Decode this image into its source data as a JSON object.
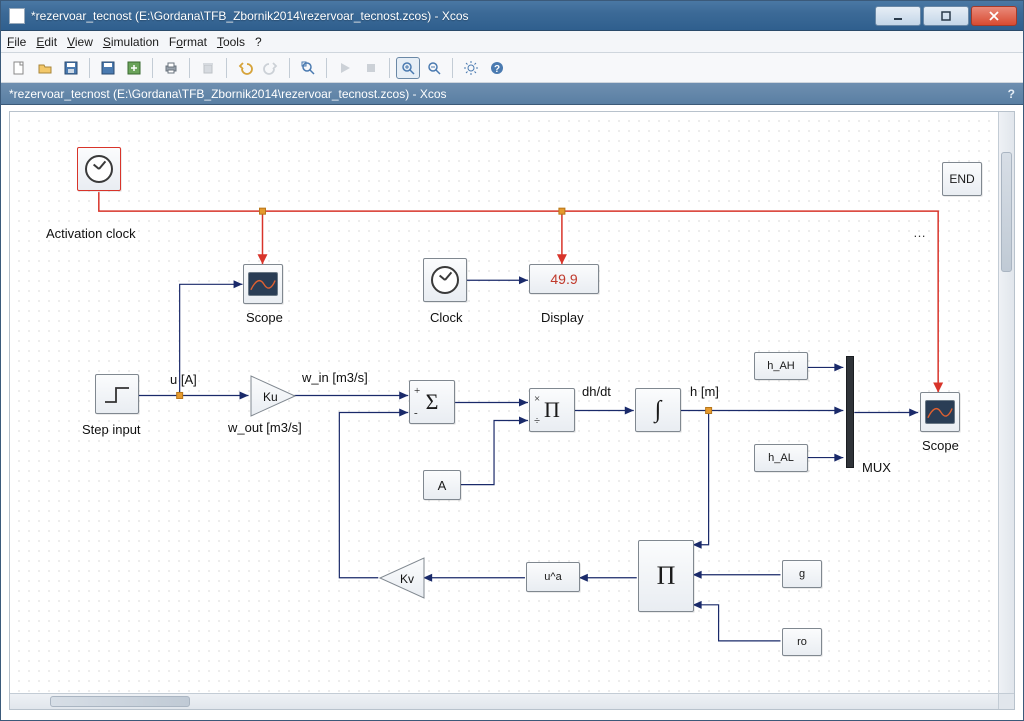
{
  "window": {
    "title": "*rezervoar_tecnost (E:\\Gordana\\TFB_Zbornik2014\\rezervoar_tecnost.zcos) - Xcos"
  },
  "menu": {
    "file": "File",
    "edit": "Edit",
    "view": "View",
    "simulation": "Simulation",
    "format": "Format",
    "tools": "Tools",
    "help": "?"
  },
  "toolbar": {
    "new": "new",
    "open": "open",
    "save": "save",
    "save_dlg": "save-as",
    "print": "print",
    "cut": "cut",
    "copy": "copy",
    "paste": "paste",
    "undo": "undo",
    "redo": "redo",
    "fit": "fit",
    "play": "play",
    "stop": "stop",
    "zoom_in": "zoom-in",
    "zoom_out": "zoom-out",
    "settings": "settings",
    "about": "about"
  },
  "tab": {
    "label": "*rezervoar_tecnost (E:\\Gordana\\TFB_Zbornik2014\\rezervoar_tecnost.zcos) - Xcos",
    "help": "?"
  },
  "labels": {
    "activation_clock": "Activation clock",
    "scope1": "Scope",
    "clock": "Clock",
    "display": "Display",
    "step": "Step input",
    "u": "u [A]",
    "w_in": "w_in [m3/s]",
    "w_out": "w_out [m3/s]",
    "dhdt": "dh/dt",
    "h": "h [m]",
    "mux": "MUX",
    "scope2": "Scope"
  },
  "blocks": {
    "end": "END",
    "display_value": "49.9",
    "ku": "Ku",
    "sum": "Σ",
    "sum_plus": "+",
    "sum_minus": "-",
    "prod1": "Π",
    "prod1_mul": "×",
    "prod1_div": "÷",
    "integ": "∫",
    "A": "A",
    "h_ah": "h_AH",
    "h_al": "h_AL",
    "prod2": "Π",
    "ua": "u^a",
    "kv": "Kv",
    "g": "g",
    "ro": "ro"
  }
}
